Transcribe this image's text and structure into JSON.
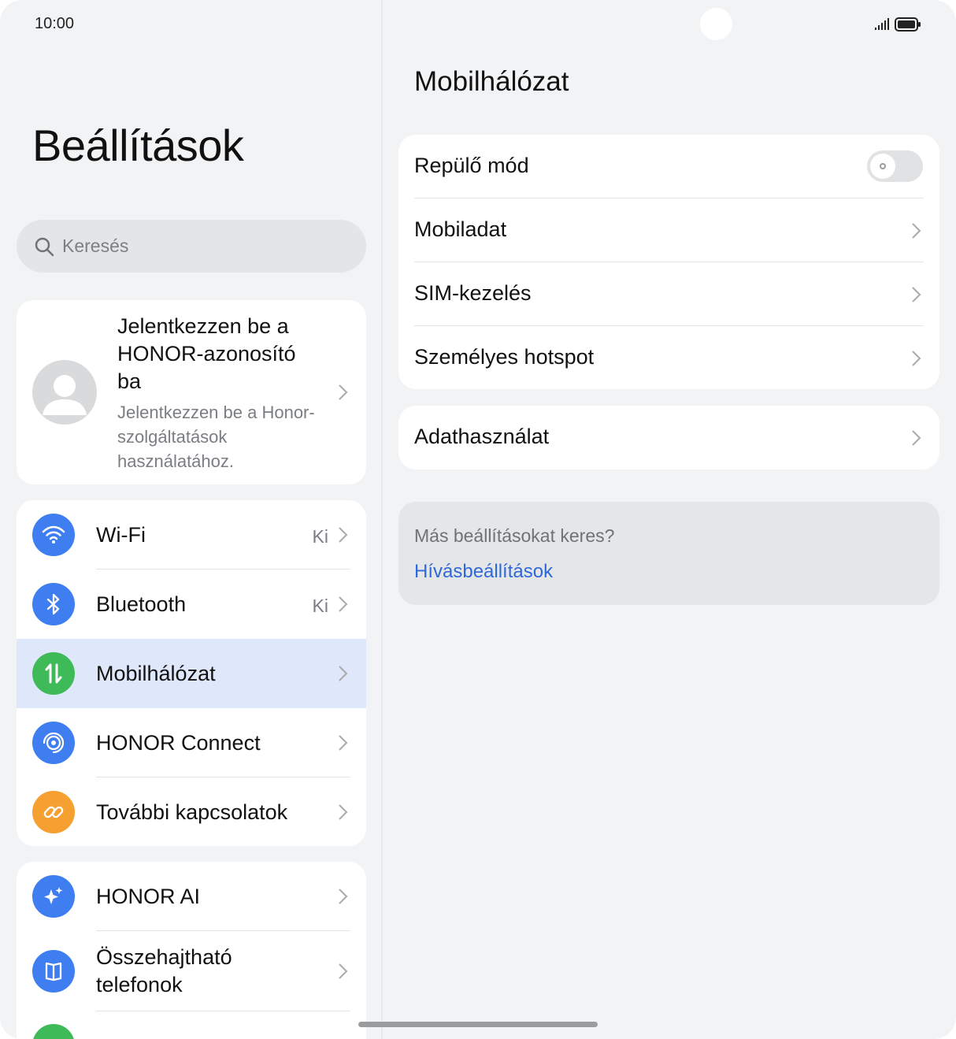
{
  "status_bar": {
    "time": "10:00",
    "signal_icon": "signal-icon",
    "battery_icon": "battery-icon"
  },
  "left": {
    "title": "Beállítások",
    "search": {
      "placeholder": "Keresés",
      "icon": "search-icon"
    },
    "account": {
      "title": "Jelentkezzen be a HONOR-azonosító ba",
      "subtitle": "Jelentkezzen be a Honor-szolgáltatások használatához.",
      "icon": "avatar-icon"
    },
    "connectivity": [
      {
        "label": "Wi-Fi",
        "value": "Ki",
        "icon": "wifi-icon",
        "color": "#3e7ef0"
      },
      {
        "label": "Bluetooth",
        "value": "Ki",
        "icon": "bluetooth-icon",
        "color": "#3e7ef0"
      },
      {
        "label": "Mobilhálózat",
        "value": "",
        "icon": "mobile-data-icon",
        "color": "#3fba59"
      },
      {
        "label": "HONOR Connect",
        "value": "",
        "icon": "honor-connect-icon",
        "color": "#3e7ef0"
      },
      {
        "label": "További kapcsolatok",
        "value": "",
        "icon": "link-icon",
        "color": "#f5a031"
      }
    ],
    "other": [
      {
        "label": "HONOR AI",
        "icon": "ai-sparkle-icon",
        "color": "#3e7ef0"
      },
      {
        "label": "Összehajtható telefonok",
        "icon": "foldable-icon",
        "color": "#3e7ef0"
      }
    ]
  },
  "right": {
    "title": "Mobilhálózat",
    "group1": [
      {
        "label": "Repülő mód",
        "type": "toggle",
        "on": false
      },
      {
        "label": "Mobiladat",
        "type": "link"
      },
      {
        "label": "SIM-kezelés",
        "type": "link"
      },
      {
        "label": "Személyes hotspot",
        "type": "link"
      }
    ],
    "group2": [
      {
        "label": "Adathasználat",
        "type": "link"
      }
    ],
    "suggestion": {
      "question": "Más beállításokat keres?",
      "link": "Hívásbeállítások"
    }
  },
  "colors": {
    "accent": "#2f68d8",
    "selected_row": "#dfe8fb",
    "background": "#f1f3f5"
  }
}
